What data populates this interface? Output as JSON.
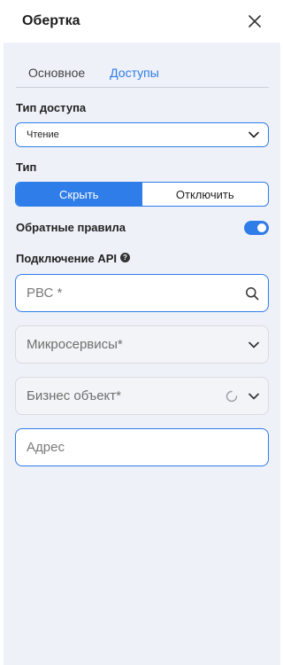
{
  "header": {
    "title": "Обертка"
  },
  "tabs": [
    {
      "label": "Основное"
    },
    {
      "label": "Доступы"
    }
  ],
  "access_type": {
    "label": "Тип доступа",
    "value": "Чтение"
  },
  "type": {
    "label": "Тип",
    "options": [
      "Скрыть",
      "Отключить"
    ],
    "selected": "Скрыть"
  },
  "reverse_rules": {
    "label": "Обратные правила",
    "enabled": true
  },
  "api": {
    "label": "Подключение API",
    "help_icon": "?",
    "rvs_placeholder": "РВС *",
    "microservices_placeholder": "Микросервисы*",
    "business_object_placeholder": "Бизнес объект*",
    "address_placeholder": "Адрес"
  },
  "colors": {
    "accent": "#2f7de8",
    "panel_bg": "#eef1f8"
  }
}
